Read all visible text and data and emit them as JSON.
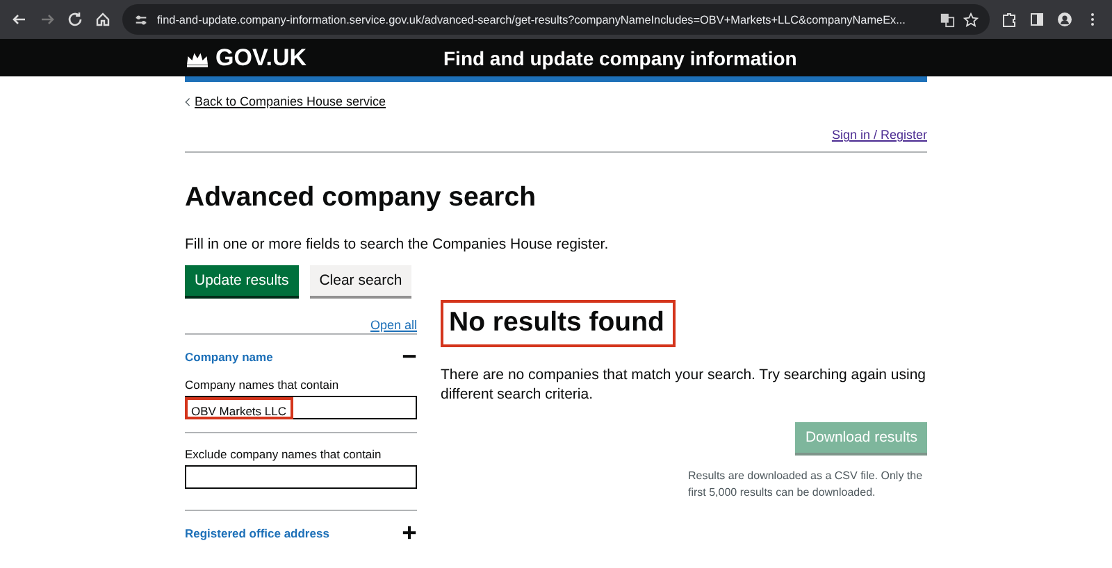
{
  "browser": {
    "url": "find-and-update.company-information.service.gov.uk/advanced-search/get-results?companyNameIncludes=OBV+Markets+LLC&companyNameEx..."
  },
  "header": {
    "logo": "GOV.UK",
    "service": "Find and update company information"
  },
  "back_link": "Back to Companies House service",
  "sign_in": "Sign in / Register",
  "title": "Advanced company search",
  "intro": "Fill in one or more fields to search the Companies House register.",
  "buttons": [
    {
      "label": "Update results",
      "kind": "primary"
    },
    {
      "label": "Clear search",
      "kind": "secondary"
    }
  ],
  "open_all": "Open all",
  "sections": [
    {
      "title": "Company name",
      "expanded": true,
      "fields": [
        {
          "label": "Company names that contain",
          "value": "OBV Markets LLC",
          "annotated": true
        },
        {
          "label": "Exclude company names that contain"
        }
      ]
    },
    {
      "title": "Registered office address",
      "expanded": false
    }
  ],
  "results": {
    "heading": "No results found",
    "annotated": true,
    "message": "There are no companies that match your search. Try searching again using different search criteria.",
    "download": {
      "label": "Download results",
      "disabled": true
    },
    "note": "Results are downloaded as a CSV file. Only the first 5,000 results can be downloaded."
  }
}
